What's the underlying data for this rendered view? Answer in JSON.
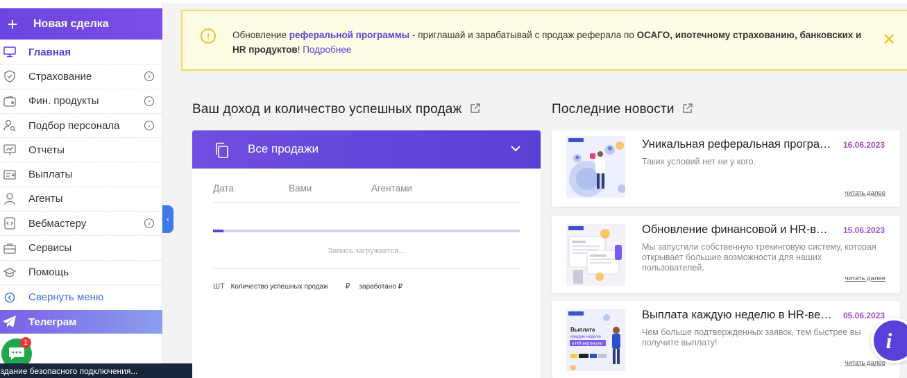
{
  "sidebar": {
    "new_deal": "Новая сделка",
    "items": [
      {
        "label": "Главная",
        "icon": "monitor-icon",
        "active": true,
        "arrow": false
      },
      {
        "label": "Страхование",
        "icon": "shield-check-icon",
        "arrow": true
      },
      {
        "label": "Фин. продукты",
        "icon": "wallet-icon",
        "arrow": true
      },
      {
        "label": "Подбор персонала",
        "icon": "user-search-icon",
        "arrow": true
      },
      {
        "label": "Отчеты",
        "icon": "presentation-icon",
        "arrow": false
      },
      {
        "label": "Выплаты",
        "icon": "invoice-icon",
        "arrow": false
      },
      {
        "label": "Агенты",
        "icon": "person-icon",
        "arrow": false
      },
      {
        "label": "Вебмастеру",
        "icon": "code-window-icon",
        "arrow": true
      },
      {
        "label": "Сервисы",
        "icon": "briefcase-icon",
        "arrow": false
      },
      {
        "label": "Помощь",
        "icon": "graduation-cap-icon",
        "arrow": false
      },
      {
        "label": "Свернуть меню",
        "icon": "circle-chevron-left-icon",
        "arrow": false
      }
    ],
    "telegram": "Телеграм",
    "chat_badge": "1"
  },
  "status_bar": "оздание безопасного подключения...",
  "banner": {
    "prefix": "Обновление ",
    "link": "реферальной программы",
    "middle": " - приглашай и зарабатывай с продаж реферала по ",
    "bold": "ОСАГО, ипотечному страхованию, банковских и HR продуктов",
    "suffix": "! ",
    "more": "Подробнее"
  },
  "income": {
    "title": "Ваш доход и количество успешных продаж",
    "dropdown": "Все продажи",
    "columns": [
      "Дата",
      "Вами",
      "Агентами"
    ],
    "loading_progress": 0.035,
    "loading_text": "Запись загружается...",
    "legend_unit": "ШТ",
    "legend_count": "Количество успешных продаж",
    "legend_currency": "₽",
    "legend_earned": "заработано ₽"
  },
  "news": {
    "title": "Последние новости",
    "read_more": "читать далее",
    "items": [
      {
        "title": "Уникальная реферальная программа",
        "date": "16.06.2023",
        "desc": "Таких условий нет ни у кого."
      },
      {
        "title": "Обновление финансовой и HR-вертикали",
        "date": "15.06.2023",
        "desc": "Мы запустили собственную трекинговую систему, которая открывает большие возможности для наших пользователей."
      },
      {
        "title": "Выплата каждую неделю в HR-вертикали",
        "date": "05.06.2023",
        "desc": "Чем больше подтвержденных заявок, тем быстрее вы получите выплату!"
      }
    ]
  },
  "thumb3": {
    "line1": "Выплата",
    "line2": "каждую неделю",
    "line3": "в HR-вертикали"
  }
}
